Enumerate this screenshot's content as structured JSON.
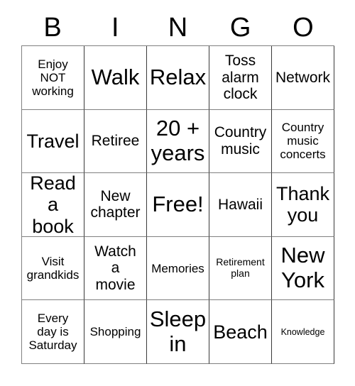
{
  "card": {
    "title": "BINGO",
    "header_letters": [
      "B",
      "I",
      "N",
      "G",
      "O"
    ],
    "free_space_label": "Free!",
    "colors": {
      "background": "#ffffff",
      "text": "#000000",
      "grid_line": "#808080",
      "grid_line_dark": "#3a3a3a"
    },
    "rows": [
      [
        {
          "text": "Enjoy\nNOT\nworking",
          "size": "sm"
        },
        {
          "text": "Walk",
          "size": "xl"
        },
        {
          "text": "Relax",
          "size": "xl"
        },
        {
          "text": "Toss\nalarm\nclock",
          "size": "md"
        },
        {
          "text": "Network",
          "size": "md"
        }
      ],
      [
        {
          "text": "Travel",
          "size": "lg"
        },
        {
          "text": "Retiree",
          "size": "md"
        },
        {
          "text": "20 +\nyears",
          "size": "xl"
        },
        {
          "text": "Country\nmusic",
          "size": "md"
        },
        {
          "text": "Country\nmusic\nconcerts",
          "size": "sm"
        }
      ],
      [
        {
          "text": "Read\na book",
          "size": "lg"
        },
        {
          "text": "New\nchapter",
          "size": "md"
        },
        {
          "text": "Free!",
          "size": "xl"
        },
        {
          "text": "Hawaii",
          "size": "md"
        },
        {
          "text": "Thank\nyou",
          "size": "lg"
        }
      ],
      [
        {
          "text": "Visit\ngrandkids",
          "size": "sm"
        },
        {
          "text": "Watch\na\nmovie",
          "size": "md"
        },
        {
          "text": "Memories",
          "size": "sm"
        },
        {
          "text": "Retirement\nplan",
          "size": "xs"
        },
        {
          "text": "New\nYork",
          "size": "xl"
        }
      ],
      [
        {
          "text": "Every\nday is\nSaturday",
          "size": "sm"
        },
        {
          "text": "Shopping",
          "size": "sm"
        },
        {
          "text": "Sleep\nin",
          "size": "xl"
        },
        {
          "text": "Beach",
          "size": "lg"
        },
        {
          "text": "Knowledge",
          "size": "xxs"
        }
      ]
    ]
  }
}
